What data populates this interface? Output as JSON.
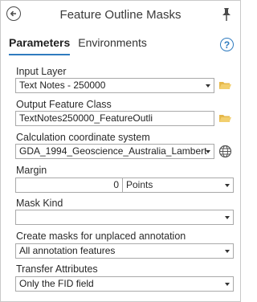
{
  "header": {
    "title": "Feature Outline Masks"
  },
  "tabs": [
    {
      "label": "Parameters",
      "active": true
    },
    {
      "label": "Environments",
      "active": false
    }
  ],
  "params": {
    "input_layer": {
      "label": "Input Layer",
      "value": "Text Notes - 250000"
    },
    "output_feature_class": {
      "label": "Output Feature Class",
      "value": "TextNotes250000_FeatureOutli"
    },
    "coordinate_system": {
      "label": "Calculation coordinate system",
      "value": "GDA_1994_Geoscience_Australia_Lambert"
    },
    "margin": {
      "label": "Margin",
      "value": "0",
      "units": "Points"
    },
    "mask_kind": {
      "label": "Mask Kind",
      "value": ""
    },
    "unplaced": {
      "label": "Create masks for unplaced annotation",
      "value": "All annotation features"
    },
    "transfer": {
      "label": "Transfer Attributes",
      "value": "Only the FID field"
    }
  },
  "icons": {
    "back": "back-arrow-icon",
    "pin": "pin-icon",
    "help": "help-icon",
    "folder": "folder-icon",
    "globe": "globe-icon"
  },
  "colors": {
    "accent": "#2f7bbf",
    "folder": "#e6b84a"
  }
}
